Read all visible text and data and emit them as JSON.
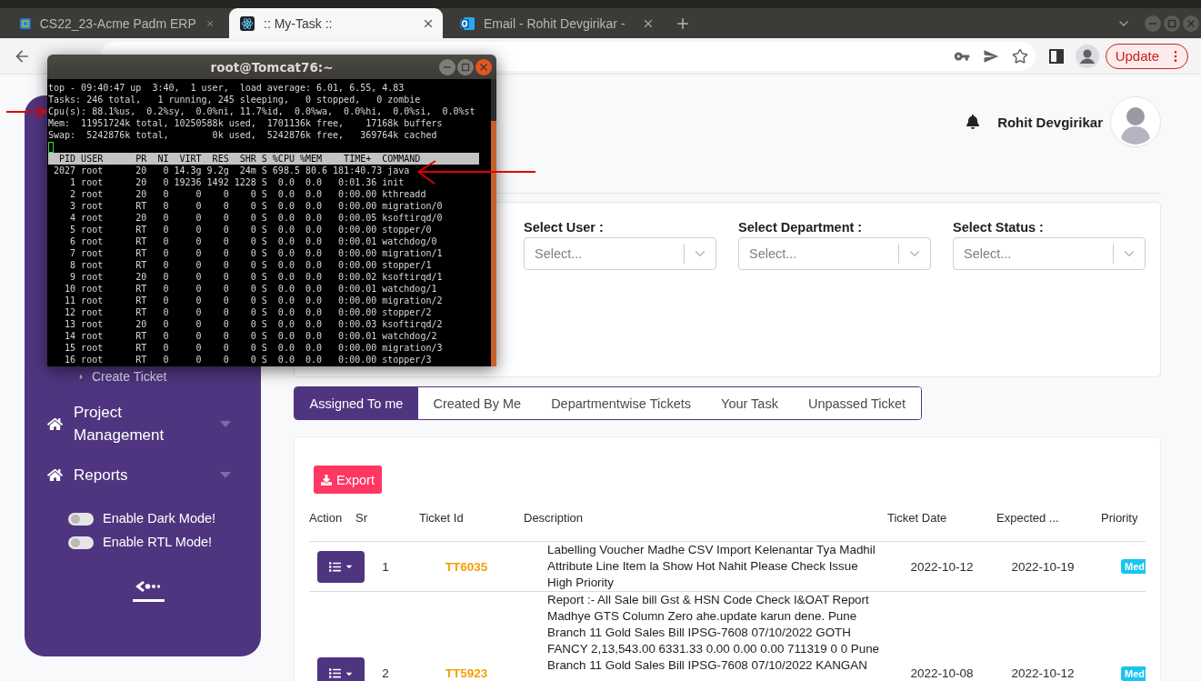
{
  "browser": {
    "tabs": [
      {
        "title": "CS22_23-Acme Padm ERP",
        "selected": false
      },
      {
        "title": ":: My-Task ::",
        "selected": true
      },
      {
        "title": "Email - Rohit Devgirikar -",
        "selected": false
      }
    ],
    "update_button": "Update"
  },
  "terminal": {
    "title": "root@Tomcat76:~",
    "summary": [
      "top - 09:40:47 up  3:40,  1 user,  load average: 6.01, 6.55, 4.83",
      "Tasks: 246 total,   1 running, 245 sleeping,   0 stopped,   0 zombie",
      "Cpu(s): 88.1%us,  0.2%sy,  0.0%ni, 11.7%id,  0.0%wa,  0.0%hi,  0.0%si,  0.0%st",
      "Mem:  11951724k total, 10250588k used,  1701136k free,    17168k buffers",
      "Swap:  5242876k total,        0k used,  5242876k free,   369764k cached"
    ],
    "header": "  PID USER      PR  NI  VIRT  RES  SHR S %CPU %MEM    TIME+  COMMAND",
    "processes": [
      " 2027 root      20   0 14.3g 9.2g  24m S 698.5 80.6 181:40.73 java",
      "    1 root      20   0 19236 1492 1228 S  0.0  0.0   0:01.36 init",
      "    2 root      20   0     0    0    0 S  0.0  0.0   0:00.00 kthreadd",
      "    3 root      RT   0     0    0    0 S  0.0  0.0   0:00.00 migration/0",
      "    4 root      20   0     0    0    0 S  0.0  0.0   0:00.05 ksoftirqd/0",
      "    5 root      RT   0     0    0    0 S  0.0  0.0   0:00.00 stopper/0",
      "    6 root      RT   0     0    0    0 S  0.0  0.0   0:00.01 watchdog/0",
      "    7 root      RT   0     0    0    0 S  0.0  0.0   0:00.00 migration/1",
      "    8 root      RT   0     0    0    0 S  0.0  0.0   0:00.00 stopper/1",
      "    9 root      20   0     0    0    0 S  0.0  0.0   0:00.02 ksoftirqd/1",
      "   10 root      RT   0     0    0    0 S  0.0  0.0   0:00.01 watchdog/1",
      "   11 root      RT   0     0    0    0 S  0.0  0.0   0:00.00 migration/2",
      "   12 root      RT   0     0    0    0 S  0.0  0.0   0:00.00 stopper/2",
      "   13 root      20   0     0    0    0 S  0.0  0.0   0:00.03 ksoftirqd/2",
      "   14 root      RT   0     0    0    0 S  0.0  0.0   0:00.01 watchdog/2",
      "   15 root      RT   0     0    0    0 S  0.0  0.0   0:00.00 migration/3",
      "   16 root      RT   0     0    0    0 S  0.0  0.0   0:00.00 stopper/3"
    ]
  },
  "sidebar": {
    "items": [
      {
        "kind": "subitem",
        "label": "Create Ticket"
      },
      {
        "kind": "menu",
        "label": "Project Management"
      },
      {
        "kind": "menu",
        "label": "Reports"
      }
    ],
    "toggles": [
      {
        "label": "Enable Dark Mode!",
        "on": false
      },
      {
        "label": "Enable RTL Mode!",
        "on": false
      }
    ]
  },
  "header": {
    "user_name": "Rohit Devgirikar"
  },
  "filters": [
    {
      "label": "Select User :",
      "placeholder": "Select..."
    },
    {
      "label": "Select Department :",
      "placeholder": "Select..."
    },
    {
      "label": "Select Status :",
      "placeholder": "Select..."
    }
  ],
  "tabs": [
    {
      "label": "Assigned To me",
      "selected": true
    },
    {
      "label": "Created By Me",
      "selected": false
    },
    {
      "label": "Departmentwise Tickets",
      "selected": false
    },
    {
      "label": "Your Task",
      "selected": false
    },
    {
      "label": "Unpassed Ticket",
      "selected": false
    }
  ],
  "export_button": "Export",
  "table": {
    "columns": [
      "Action",
      "Sr",
      "Ticket Id",
      "Description",
      "Ticket Date",
      "Expected ...",
      "Priority"
    ],
    "rows": [
      {
        "sr": "1",
        "ticket_id": "TT6035",
        "description": "Labelling Voucher Madhe CSV Import Kelenantar Tya Madhil Attribute Line Item la Show Hot Nahit Please Check Issue High Priority",
        "ticket_date": "2022-10-12",
        "expected": "2022-10-19",
        "priority": "Med"
      },
      {
        "sr": "2",
        "ticket_id": "TT5923",
        "description": "Report :- All Sale bill Gst & HSN Code Check I&OAT Report Madhye GTS Column Zero ahe.update karun dene. Pune Branch 11 Gold Sales Bill IPSG-7608 07/10/2022 GOTH FANCY 2,13,543.00 6331.33 0.00 0.00 0.00 711319 0 0 Pune Branch 11 Gold Sales Bill IPSG-7608 07/10/2022 KANGAN",
        "ticket_date": "2022-10-08",
        "expected": "2022-10-12",
        "priority": "Med"
      }
    ]
  }
}
